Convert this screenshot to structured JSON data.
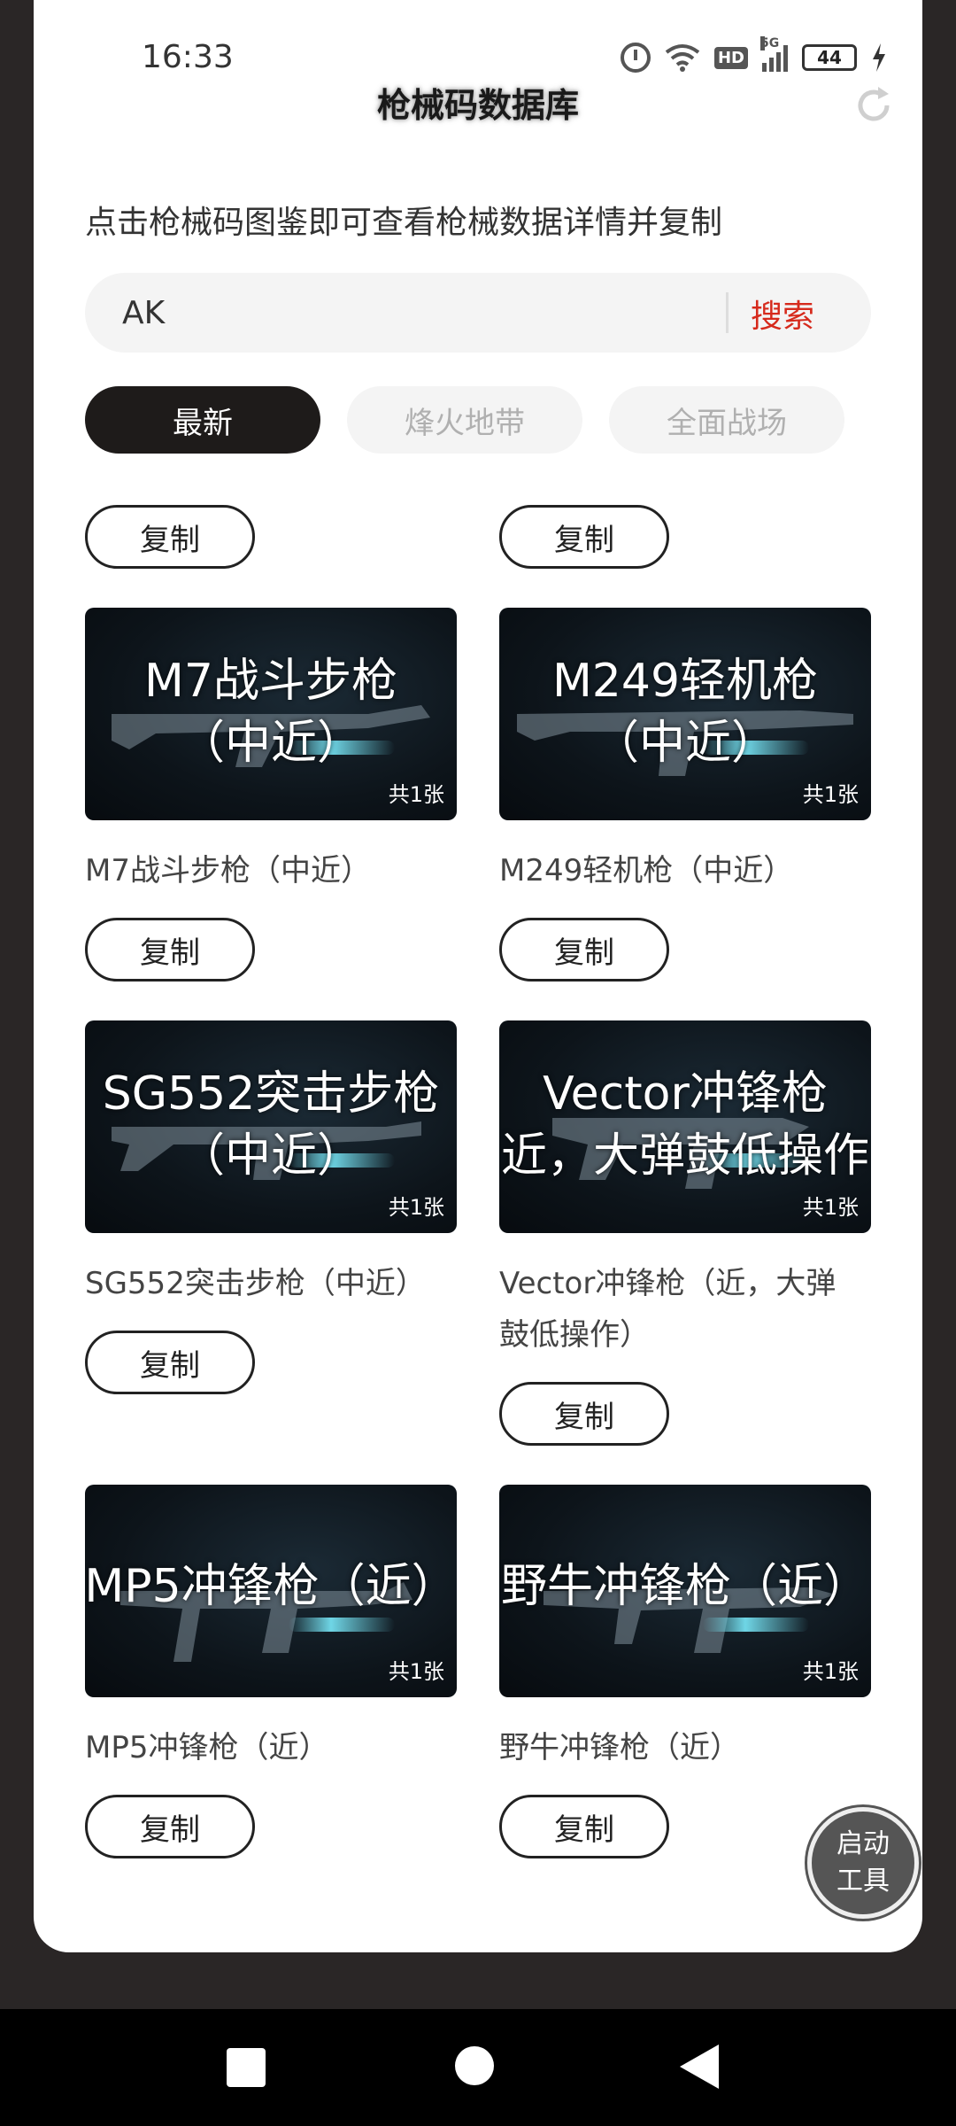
{
  "status_bar": {
    "time": "16:33",
    "battery": "44",
    "network_label": "5G",
    "hd_label": "HD",
    "icons": [
      "alarm-icon",
      "wifi-icon",
      "hd-icon",
      "signal-icon",
      "battery-icon",
      "charging-icon"
    ]
  },
  "header": {
    "title": "枪械码数据库",
    "refresh_icon": "refresh-icon"
  },
  "subtitle": "点击枪械码图鉴即可查看枪械数据详情并复制",
  "search": {
    "value": "AK",
    "button_label": "搜索"
  },
  "tabs": [
    {
      "label": "最新",
      "active": true
    },
    {
      "label": "烽火地带",
      "active": false
    },
    {
      "label": "全面战场",
      "active": false
    }
  ],
  "copy_label": "复制",
  "top_partial_row": {
    "buttons": [
      "复制",
      "复制"
    ]
  },
  "cards": [
    {
      "overlay_line1": "M7战斗步枪",
      "overlay_line2": "（中近）",
      "count": "共1张",
      "title": "M7战斗步枪（中近）"
    },
    {
      "overlay_line1": "M249轻机枪",
      "overlay_line2": "（中近）",
      "count": "共1张",
      "title": "M249轻机枪（中近）"
    },
    {
      "overlay_line1": "SG552突击步枪",
      "overlay_line2": "（中近）",
      "count": "共1张",
      "title": "SG552突击步枪（中近）"
    },
    {
      "overlay_line1": "Vector冲锋枪",
      "overlay_line2": "近，大弹鼓低操作",
      "count": "共1张",
      "title_line1": "Vector冲锋枪（近，大弹",
      "title_line2": "鼓低操作）"
    },
    {
      "overlay_line1": "MP5冲锋枪（近）",
      "overlay_line2": "",
      "count": "共1张",
      "title": "MP5冲锋枪（近）"
    },
    {
      "overlay_line1": "野牛冲锋枪（近）",
      "overlay_line2": "",
      "count": "共1张",
      "title": "野牛冲锋枪（近）"
    }
  ],
  "floating_button": {
    "line1": "启动",
    "line2": "工具"
  },
  "nav_bar": {
    "icons": [
      "recent-apps-icon",
      "home-icon",
      "back-icon"
    ]
  }
}
